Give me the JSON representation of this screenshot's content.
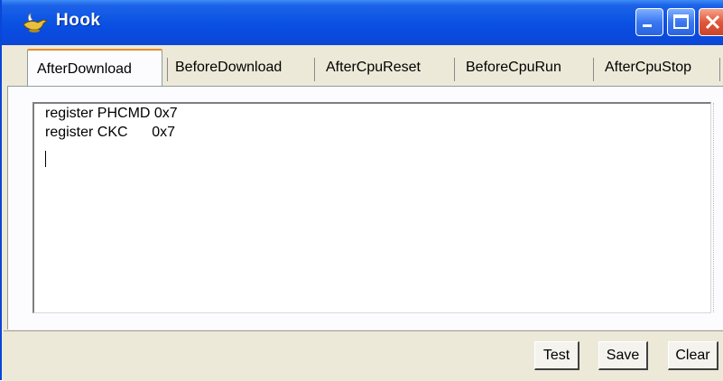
{
  "window": {
    "title": "Hook"
  },
  "tabs": [
    {
      "label": "AfterDownload",
      "active": true
    },
    {
      "label": "BeforeDownload",
      "active": false
    },
    {
      "label": "AfterCpuReset",
      "active": false
    },
    {
      "label": "BeforeCpuRun",
      "active": false
    },
    {
      "label": "AfterCpuStop",
      "active": false
    }
  ],
  "editor": {
    "lines": [
      "register PHCMD 0x7",
      "register CKC      0x7"
    ]
  },
  "buttons": {
    "test": "Test",
    "save": "Save",
    "clear": "Clear"
  },
  "icons": {
    "app": "genie-lamp-icon",
    "minimize": "minimize-icon",
    "maximize": "maximize-icon",
    "close": "close-icon"
  },
  "colors": {
    "titlebar": "#0a4be0",
    "active_tab_accent": "#e68b2c",
    "close_button": "#e0583a"
  }
}
